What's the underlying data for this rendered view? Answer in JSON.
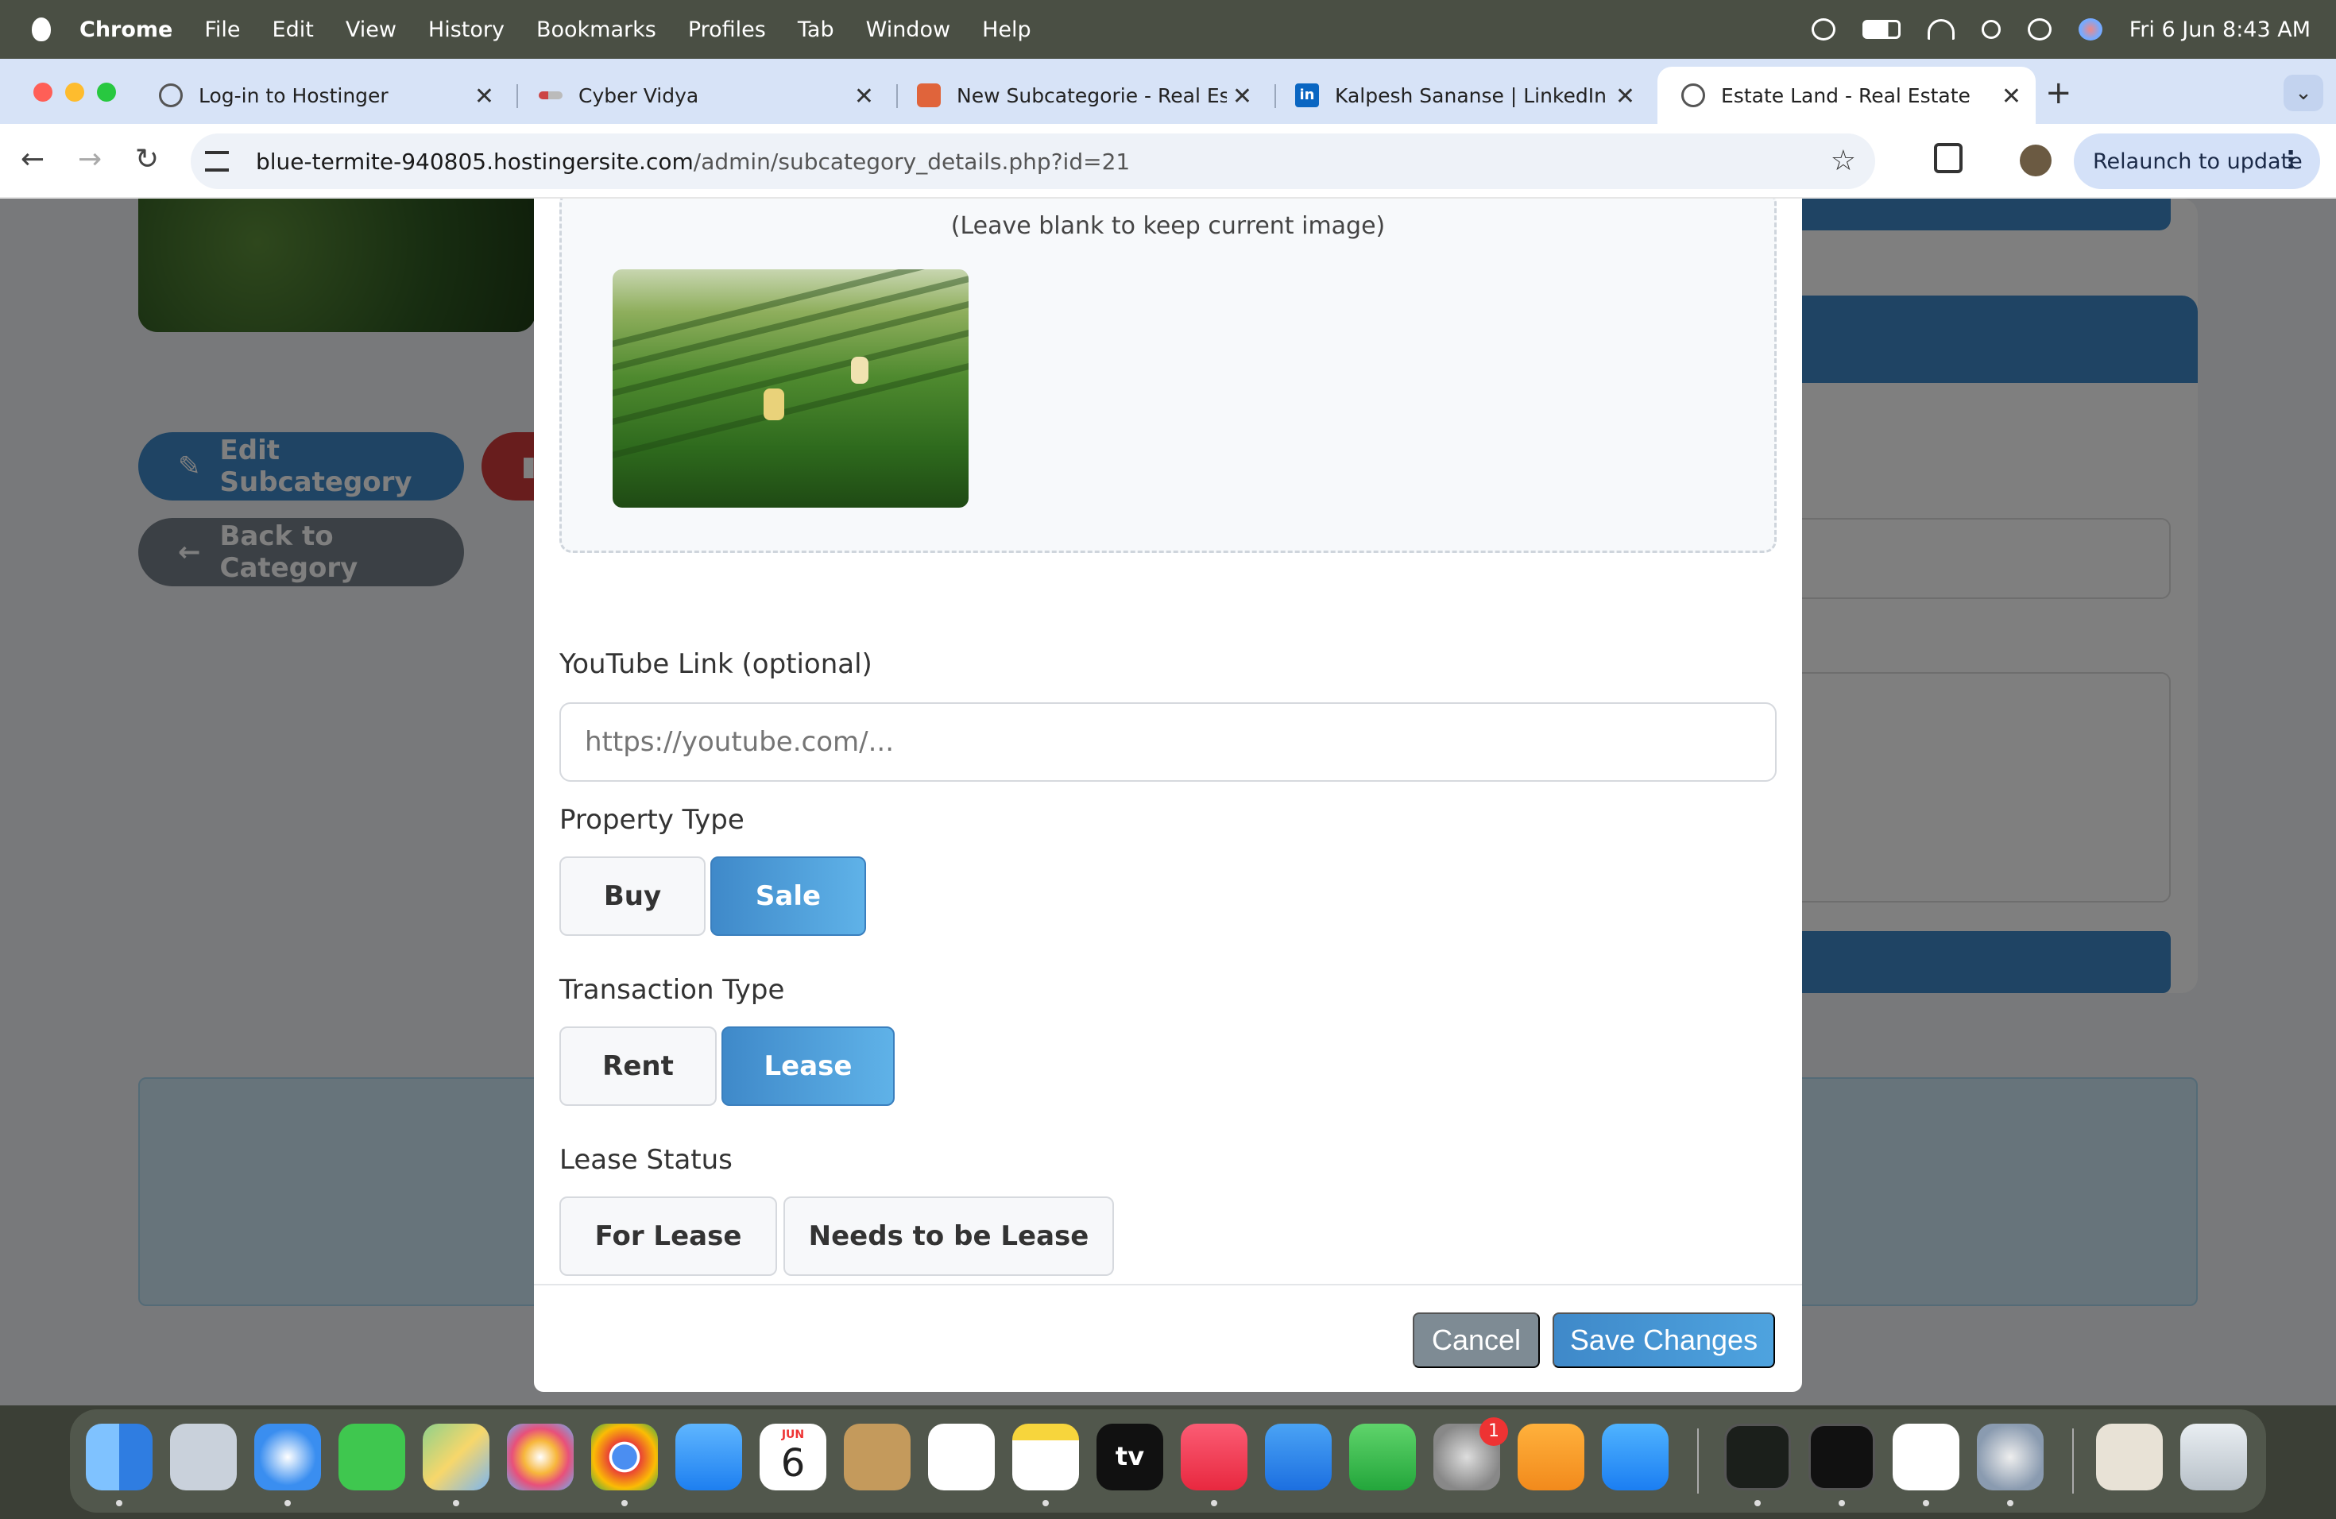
{
  "menubar": {
    "app_name": "Chrome",
    "menus": [
      "File",
      "Edit",
      "View",
      "History",
      "Bookmarks",
      "Profiles",
      "Tab",
      "Window",
      "Help"
    ],
    "clock": "Fri 6 Jun  8:43 AM"
  },
  "tabs": [
    {
      "title": "Log-in to Hostinger",
      "icon": "globe-icon"
    },
    {
      "title": "Cyber Vidya",
      "icon": "cyber-vidya-icon"
    },
    {
      "title": "New Subcategorie - Real Esta",
      "icon": "hostinger-icon"
    },
    {
      "title": "Kalpesh Sananse | LinkedIn",
      "icon": "linkedin-icon"
    },
    {
      "title": "Estate Land - Real Estate",
      "icon": "globe-icon",
      "active": true
    }
  ],
  "address_bar": {
    "host": "blue-termite-940805.hostingersite.com",
    "path": "/admin/subcategory_details.php?id=21"
  },
  "toolbar": {
    "relaunch_label": "Relaunch to update"
  },
  "background_page": {
    "edit_button": "Edit Subcategory",
    "back_button": "Back to Category"
  },
  "modal": {
    "image_hint": "(Leave blank to keep current image)",
    "youtube": {
      "label": "YouTube Link (optional)",
      "placeholder": "https://youtube.com/..."
    },
    "property_type": {
      "label": "Property Type",
      "options": [
        "Buy",
        "Sale"
      ],
      "selected": "Sale"
    },
    "transaction_type": {
      "label": "Transaction Type",
      "options": [
        "Rent",
        "Lease"
      ],
      "selected": "Lease"
    },
    "lease_status": {
      "label": "Lease Status",
      "options": [
        "For Lease",
        "Needs to be Lease"
      ],
      "selected": ""
    },
    "cancel_label": "Cancel",
    "save_label": "Save Changes"
  },
  "dock": {
    "apps": [
      "finder",
      "launchpad",
      "safari",
      "messages",
      "maps",
      "photos",
      "chrome",
      "mail",
      "calendar",
      "contacts",
      "reminders",
      "notes",
      "apple-tv",
      "music",
      "keynote",
      "numbers",
      "system-settings",
      "pages",
      "app-store",
      "activity-monitor",
      "terminal",
      "vscode",
      "settings-alt",
      "preview",
      "trash"
    ],
    "calendar_month": "JUN",
    "calendar_day": "6",
    "settings_badge": "1",
    "tv_label": "tv"
  }
}
